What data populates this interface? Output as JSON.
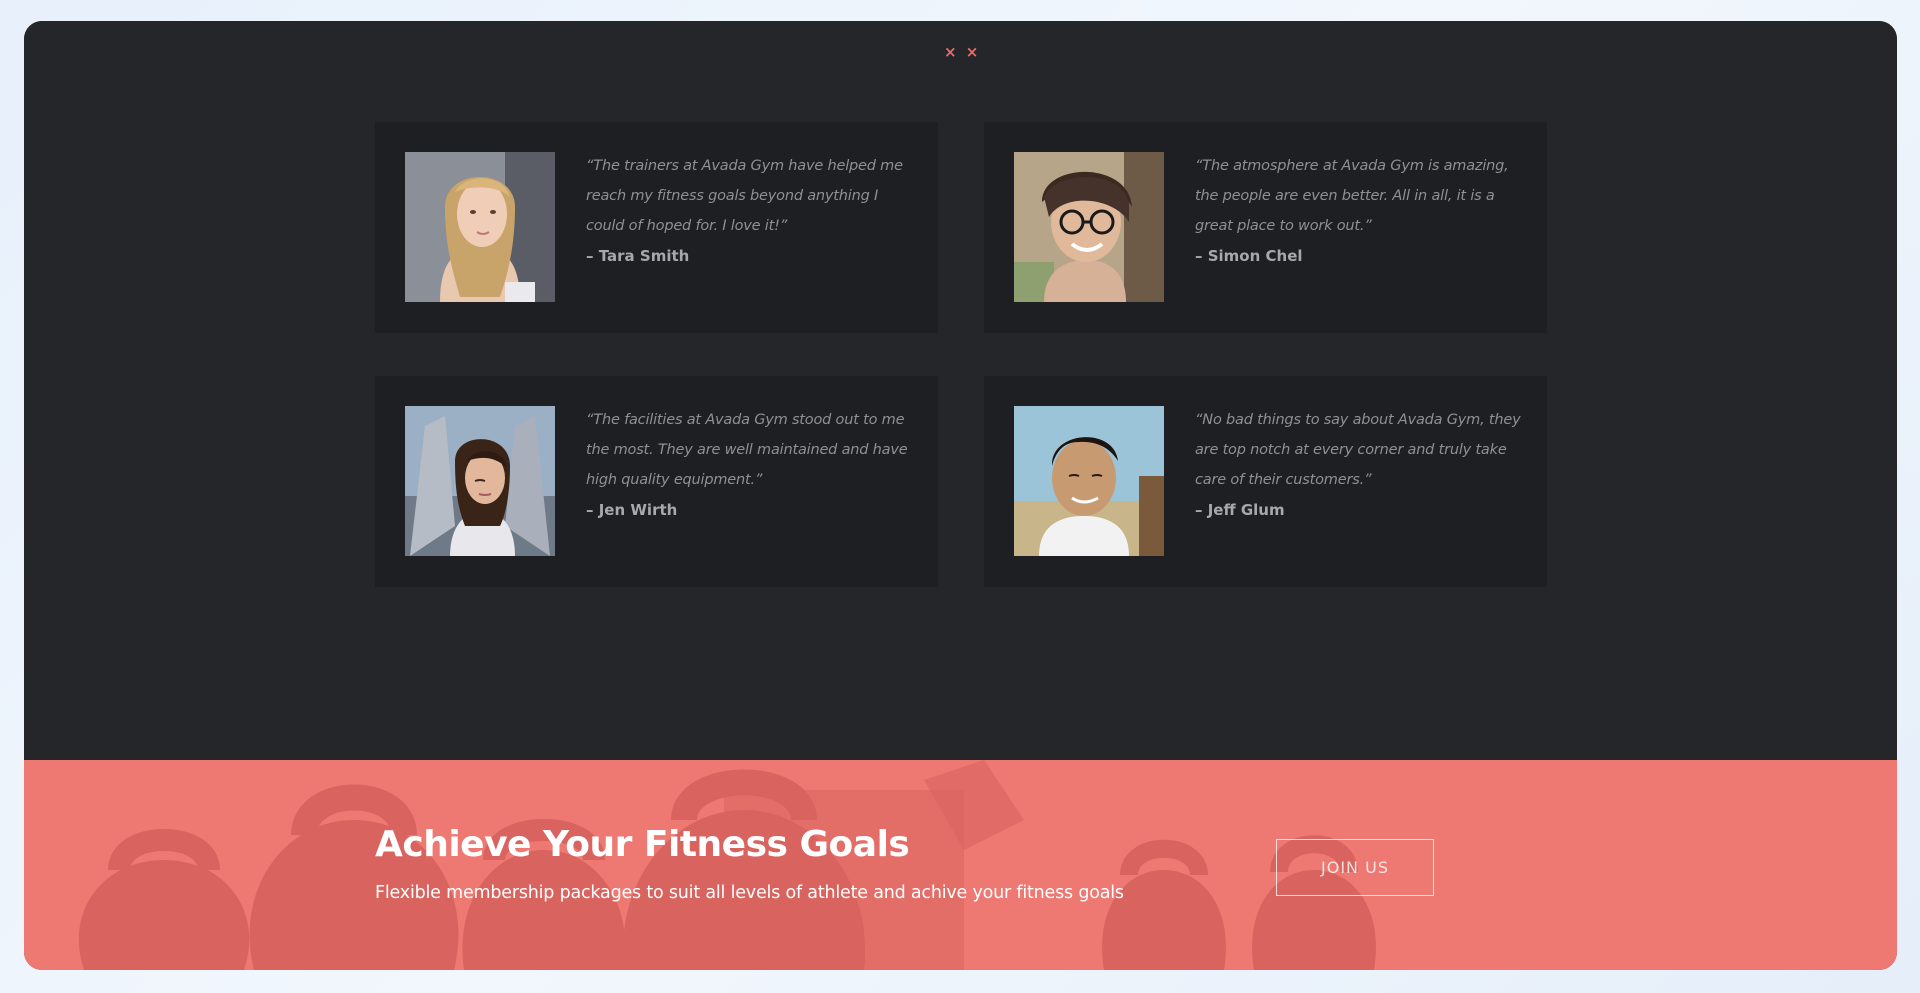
{
  "header": {
    "close_marks": "× ×"
  },
  "testimonials": [
    {
      "quote": "“The trainers at Avada Gym have helped me reach my fitness goals beyond anything I could of hoped for. I love it!”",
      "author": "– Tara Smith",
      "photo_icon": "woman-blonde-portrait"
    },
    {
      "quote": "“The atmosphere at Avada Gym is amazing, the people are even better. All in all, it is a great place to work out.”",
      "author": "– Simon Chel",
      "photo_icon": "man-glasses-portrait"
    },
    {
      "quote": "“The facilities at Avada Gym stood out to me the most.  They are well maintained and have high quality equipment.”",
      "author": "– Jen Wirth",
      "photo_icon": "woman-stretching-portrait"
    },
    {
      "quote": "“No bad things to say about Avada Gym, they are top notch at every corner and truly take care of their customers.”",
      "author": "– Jeff Glum",
      "photo_icon": "man-smiling-portrait"
    }
  ],
  "cta": {
    "title": "Achieve Your Fitness Goals",
    "subtitle": "Flexible membership packages to suit all levels of athlete and achive your fitness goals",
    "button_label": "JOIN US",
    "background_icon": "kettlebells-background"
  },
  "colors": {
    "accent": "#ee7872",
    "dark_bg": "#242629",
    "card_bg": "#1d1f22"
  }
}
